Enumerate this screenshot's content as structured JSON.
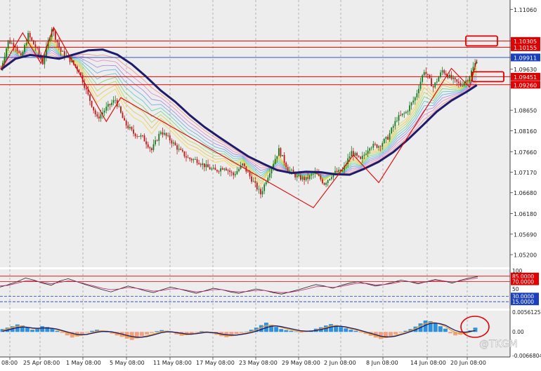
{
  "chart_data": [
    {
      "type": "candlestick",
      "panel": "price",
      "price_axis_labels": [
        "1.11060",
        "1.10305",
        "1.10155",
        "1.09911",
        "1.09630",
        "1.09451",
        "1.09260",
        "1.08650",
        "1.08160",
        "1.07660",
        "1.07170",
        "1.06680",
        "1.06180",
        "1.05690",
        "1.05200"
      ],
      "ylim": [
        1.0495,
        1.1125
      ],
      "horizontal_levels": [
        {
          "label": "1.10305",
          "value": 1.10305,
          "color": "#e00000"
        },
        {
          "label": "1.10155",
          "value": 1.10155,
          "color": "#e00000"
        },
        {
          "label": "1.09911",
          "value": 1.09911,
          "color": "#1a3fbf"
        },
        {
          "label": "1.09451",
          "value": 1.09451,
          "color": "#e00000"
        },
        {
          "label": "1.09260",
          "value": 1.0926,
          "color": "#e00000"
        }
      ],
      "moving_average": {
        "name": "",
        "color": "#1c1c6b",
        "points": [
          [
            0,
            1.0962
          ],
          [
            8,
            1.0988
          ],
          [
            16,
            1.0997
          ],
          [
            24,
            1.0993
          ],
          [
            32,
            1.0988
          ],
          [
            40,
            1.0998
          ],
          [
            48,
            1.1008
          ],
          [
            56,
            1.101
          ],
          [
            64,
            1.0998
          ],
          [
            72,
            1.0975
          ],
          [
            80,
            1.0945
          ],
          [
            88,
            1.0912
          ],
          [
            96,
            1.0885
          ],
          [
            104,
            1.0853
          ],
          [
            112,
            1.0825
          ],
          [
            120,
            1.0801
          ],
          [
            128,
            1.0778
          ],
          [
            136,
            1.0755
          ],
          [
            144,
            1.0738
          ],
          [
            152,
            1.0722
          ],
          [
            160,
            1.0715
          ],
          [
            168,
            1.0718
          ],
          [
            176,
            1.0717
          ],
          [
            184,
            1.0712
          ],
          [
            192,
            1.0711
          ],
          [
            200,
            1.0725
          ],
          [
            208,
            1.0742
          ],
          [
            216,
            1.0765
          ],
          [
            224,
            1.0795
          ],
          [
            232,
            1.0828
          ],
          [
            240,
            1.0862
          ],
          [
            248,
            1.0888
          ],
          [
            256,
            1.0908
          ],
          [
            262,
            1.0925
          ]
        ]
      },
      "close_series": [
        [
          0,
          1.0965
        ],
        [
          4,
          1.103
        ],
        [
          8,
          1.102
        ],
        [
          11,
          1.099
        ],
        [
          15,
          1.1045
        ],
        [
          20,
          1.1008
        ],
        [
          23,
          1.0978
        ],
        [
          28,
          1.1062
        ],
        [
          33,
          1.1005
        ],
        [
          38,
          1.0985
        ],
        [
          43,
          1.096
        ],
        [
          48,
          1.09
        ],
        [
          53,
          1.0845
        ],
        [
          58,
          1.087
        ],
        [
          63,
          1.089
        ],
        [
          68,
          1.0835
        ],
        [
          73,
          1.081
        ],
        [
          78,
          1.08
        ],
        [
          83,
          1.077
        ],
        [
          88,
          1.0815
        ],
        [
          93,
          1.0795
        ],
        [
          98,
          1.077
        ],
        [
          103,
          1.075
        ],
        [
          108,
          1.0745
        ],
        [
          113,
          1.073
        ],
        [
          118,
          1.072
        ],
        [
          123,
          1.073
        ],
        [
          128,
          1.071
        ],
        [
          133,
          1.0735
        ],
        [
          138,
          1.07
        ],
        [
          143,
          1.0665
        ],
        [
          148,
          1.072
        ],
        [
          153,
          1.077
        ],
        [
          158,
          1.0725
        ],
        [
          163,
          1.0705
        ],
        [
          168,
          1.07
        ],
        [
          173,
          1.0715
        ],
        [
          178,
          1.069
        ],
        [
          183,
          1.0715
        ],
        [
          188,
          1.072
        ],
        [
          193,
          1.0765
        ],
        [
          198,
          1.0745
        ],
        [
          203,
          1.078
        ],
        [
          208,
          1.078
        ],
        [
          213,
          1.08
        ],
        [
          218,
          1.0845
        ],
        [
          223,
          1.086
        ],
        [
          228,
          1.0895
        ],
        [
          233,
          1.096
        ],
        [
          238,
          1.092
        ],
        [
          243,
          1.096
        ],
        [
          248,
          1.094
        ],
        [
          253,
          1.0925
        ],
        [
          257,
          1.094
        ],
        [
          262,
          1.0985
        ]
      ],
      "zigzag": [
        [
          0,
          1.0962
        ],
        [
          12,
          1.105
        ],
        [
          22,
          1.0977
        ],
        [
          29,
          1.1063
        ],
        [
          58,
          1.0838
        ],
        [
          66,
          1.0895
        ],
        [
          172,
          1.0632
        ],
        [
          194,
          1.0758
        ],
        [
          208,
          1.0692
        ],
        [
          248,
          1.0965
        ],
        [
          258,
          1.092
        ],
        [
          262,
          1.0985
        ]
      ],
      "highlight_boxes": [
        {
          "label": "1.10305",
          "value": 1.10305
        },
        {
          "label": "1.09451",
          "value": 1.09451
        }
      ]
    },
    {
      "type": "line",
      "panel": "oscillator",
      "ylim": [
        0,
        100
      ],
      "tick_labels": [
        "100",
        "85.0000",
        "70.0000",
        "50",
        "30.0000",
        "15.0000"
      ],
      "levels": [
        {
          "label": "85.0000",
          "value": 85,
          "color": "#e00000"
        },
        {
          "label": "70.0000",
          "value": 70,
          "color": "#e00000"
        },
        {
          "label": "30.0000",
          "value": 30,
          "color": "#1a3fbf"
        },
        {
          "label": "15.0000",
          "value": 15,
          "color": "#1a3fbf"
        }
      ],
      "series": [
        {
          "color": "#202020",
          "values": [
            55,
            62,
            70,
            80,
            74,
            66,
            60,
            72,
            78,
            70,
            62,
            55,
            48,
            42,
            50,
            58,
            52,
            45,
            40,
            48,
            55,
            50,
            44,
            38,
            45,
            52,
            48,
            42,
            38,
            44,
            50,
            46,
            40,
            36,
            42,
            48,
            55,
            62,
            58,
            52,
            60,
            66,
            70,
            64,
            58,
            62,
            68,
            74,
            70,
            64,
            70,
            76,
            72,
            66,
            74,
            80,
            84
          ]
        },
        {
          "color": "#c02060",
          "values": [
            58,
            60,
            66,
            72,
            72,
            68,
            64,
            68,
            72,
            70,
            64,
            58,
            52,
            48,
            50,
            54,
            52,
            48,
            44,
            46,
            50,
            50,
            46,
            42,
            44,
            48,
            48,
            44,
            42,
            43,
            46,
            46,
            42,
            40,
            41,
            45,
            50,
            56,
            57,
            54,
            57,
            62,
            66,
            65,
            61,
            62,
            65,
            70,
            70,
            67,
            69,
            73,
            72,
            69,
            72,
            77,
            80
          ]
        }
      ]
    },
    {
      "type": "bar",
      "panel": "histogram",
      "tick_labels": [
        "0.00561257",
        "0.00",
        "-0.00668040"
      ],
      "ylim": [
        -0.0067,
        0.0056
      ],
      "values": [
        0.0008,
        0.0012,
        0.0016,
        0.0021,
        0.0018,
        0.0012,
        0.0006,
        0.001,
        0.0016,
        0.0014,
        0.0009,
        0.0003,
        -0.0003,
        -0.001,
        -0.0016,
        -0.0013,
        -0.0007,
        -0.0002,
        0.0003,
        0.0006,
        0.0004,
        0.0,
        -0.0005,
        -0.001,
        -0.0014,
        -0.0019,
        -0.0023,
        -0.0018,
        -0.0012,
        -0.0007,
        -0.0003,
        0.0002,
        0.0005,
        0.0003,
        -0.0002,
        -0.0007,
        -0.0011,
        -0.0009,
        -0.0005,
        -0.0002,
        0.0002,
        0.0001,
        -0.0004,
        -0.0008,
        -0.0012,
        -0.0015,
        -0.001,
        -0.0006,
        -0.0003,
        0.0001,
        0.0006,
        0.0012,
        0.0019,
        0.0026,
        0.002,
        0.0014,
        0.0008,
        0.0005,
        0.0003,
        0.0001,
        -0.0002,
        0.0001,
        0.0004,
        0.0009,
        0.0013,
        0.0018,
        0.0022,
        0.0019,
        0.0014,
        0.001,
        0.0006,
        0.0003,
        -0.0002,
        -0.0006,
        -0.0011,
        -0.0016,
        -0.002,
        -0.0017,
        -0.0012,
        -0.0007,
        -0.0002,
        0.0003,
        0.0008,
        0.0015,
        0.0024,
        0.0032,
        0.003,
        0.0024,
        0.0016,
        0.0009,
        -0.0004,
        -0.001,
        -0.0008,
        -0.0003,
        0.0004,
        0.0012
      ],
      "positive_color": "#2e90e0",
      "negative_color": "#f0a080",
      "signal_lines": [
        {
          "color": "#f0a030",
          "values": [
            0.0004,
            0.0009,
            0.0013,
            0.0016,
            0.0016,
            0.0013,
            0.001,
            0.0009,
            0.0011,
            0.0012,
            0.001,
            0.0006,
            0.0002,
            -0.0003,
            -0.0008,
            -0.001,
            -0.0009,
            -0.0006,
            -0.0002,
            0.0002,
            0.0003,
            0.0002,
            -0.0001,
            -0.0005,
            -0.0009,
            -0.0013,
            -0.0017,
            -0.0017,
            -0.0015,
            -0.0011,
            -0.0007,
            -0.0003,
            0.0001,
            0.0002,
            0.0,
            -0.0003,
            -0.0007,
            -0.0008,
            -0.0007,
            -0.0004,
            -0.0001,
            0.0,
            -0.0002,
            -0.0005,
            -0.0008,
            -0.0011,
            -0.0011,
            -0.0009,
            -0.0006,
            -0.0003,
            0.0001,
            0.0006,
            0.0012,
            0.0018,
            0.0019,
            0.0017,
            0.0013,
            0.0009,
            0.0006,
            0.0003,
            0.0001,
            0.0001,
            0.0002,
            0.0005,
            0.0009,
            0.0013,
            0.0017,
            0.0018,
            0.0016,
            0.0013,
            0.0009,
            0.0006,
            0.0002,
            -0.0002,
            -0.0007,
            -0.0011,
            -0.0015,
            -0.0016,
            -0.0014,
            -0.001,
            -0.0006,
            -0.0001,
            0.0004,
            0.001,
            0.0017,
            0.0024,
            0.0027,
            0.0026,
            0.0021,
            0.0015,
            0.0006,
            -0.0002,
            -0.0005,
            -0.0004,
            0.0,
            0.0006
          ]
        },
        {
          "color": "#1c1c6b",
          "values": [
            0.0002,
            0.0005,
            0.0009,
            0.0012,
            0.0014,
            0.0013,
            0.0011,
            0.001,
            0.0011,
            0.0011,
            0.001,
            0.0008,
            0.0004,
            0.0,
            -0.0004,
            -0.0007,
            -0.0008,
            -0.0007,
            -0.0004,
            -0.0001,
            0.0001,
            0.0001,
            0.0,
            -0.0003,
            -0.0006,
            -0.001,
            -0.0013,
            -0.0015,
            -0.0015,
            -0.0013,
            -0.001,
            -0.0006,
            -0.0002,
            0.0,
            0.0,
            -0.0002,
            -0.0004,
            -0.0006,
            -0.0006,
            -0.0005,
            -0.0003,
            -0.0001,
            -0.0002,
            -0.0003,
            -0.0006,
            -0.0008,
            -0.0009,
            -0.0009,
            -0.0007,
            -0.0005,
            -0.0002,
            0.0002,
            0.0007,
            0.0012,
            0.0016,
            0.0017,
            0.0015,
            0.0012,
            0.0009,
            0.0006,
            0.0003,
            0.0002,
            0.0002,
            0.0004,
            0.0007,
            0.001,
            0.0014,
            0.0016,
            0.0016,
            0.0014,
            0.0011,
            0.0008,
            0.0004,
            0.0,
            -0.0004,
            -0.0008,
            -0.0012,
            -0.0014,
            -0.0014,
            -0.0012,
            -0.0008,
            -0.0004,
            0.0001,
            0.0006,
            0.0012,
            0.0019,
            0.0024,
            0.0025,
            0.0023,
            0.0019,
            0.0011,
            0.0004,
            0.0,
            -0.0001,
            0.0001,
            0.0004
          ]
        }
      ]
    }
  ],
  "date_labels": [
    "08:00",
    "25 Apr 08:00",
    "1 May 08:00",
    "5 May 08:00",
    "11 May 08:00",
    "17 May 08:00",
    "23 May 08:00",
    "29 May 08:00",
    "2 Jun 08:00",
    "8 Jun 08:00",
    "14 Jun 08:00",
    "20 Jun 08:00"
  ],
  "watermark": "@TKGM",
  "colors": {
    "background": "#ffffff",
    "plot_bg": "#ededed",
    "bull": "#1a7a20",
    "bear": "#c01818",
    "level_red": "#e00000",
    "level_blue": "#1a3fbf",
    "label_red_bg": "#e00000",
    "label_blue_bg": "#1a3fbf",
    "grid": "#8a8a8a"
  }
}
